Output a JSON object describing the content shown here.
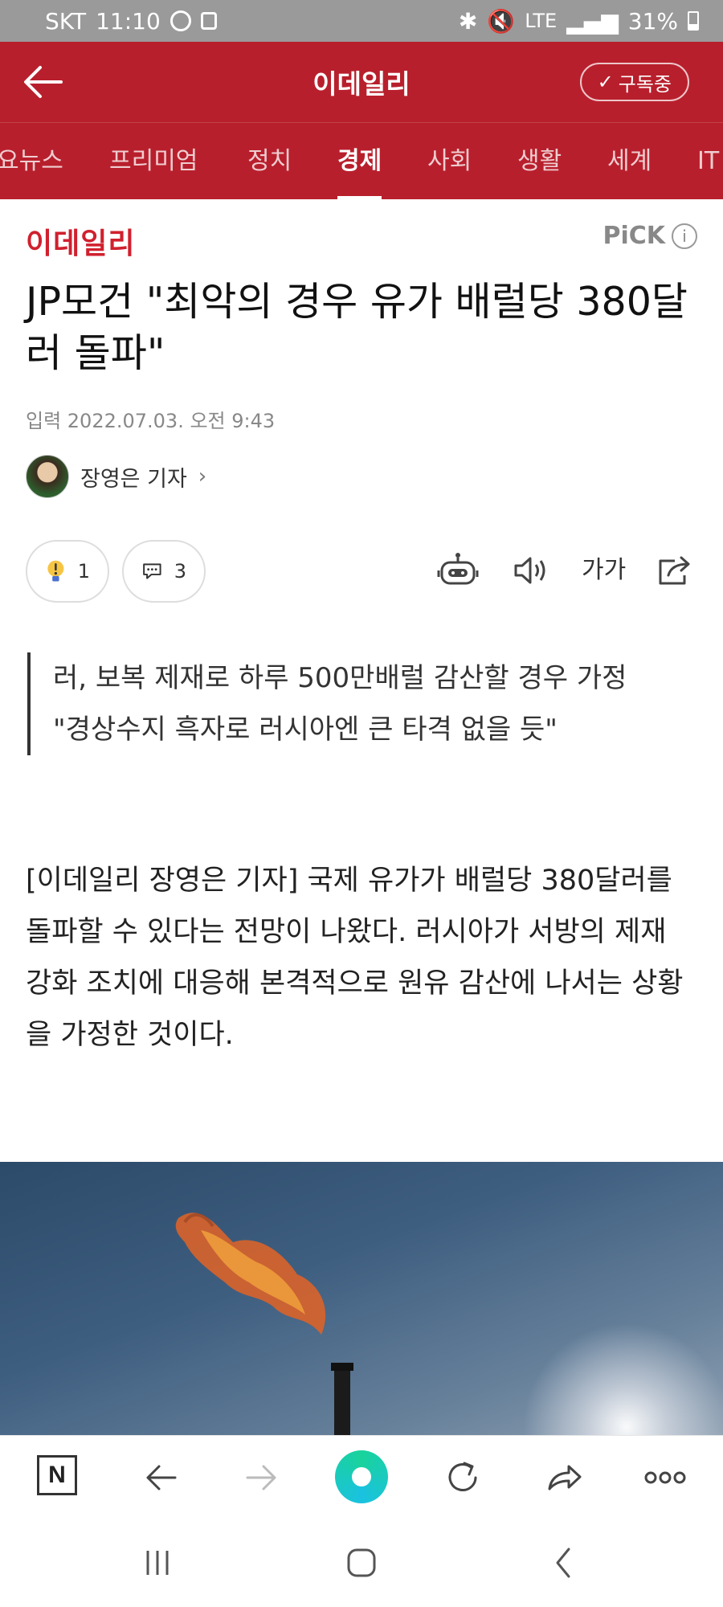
{
  "status_bar": {
    "carrier": "SKT",
    "time": "11:10",
    "network": "LTE",
    "battery": "31%"
  },
  "header": {
    "title": "이데일리",
    "subscribe_label": "구독중"
  },
  "tabs": [
    "요뉴스",
    "프리미엄",
    "정치",
    "경제",
    "사회",
    "생활",
    "세계",
    "IT"
  ],
  "active_tab": "경제",
  "article": {
    "press_logo": "이데일리",
    "pick_label": "PiCK",
    "title": "JP모건 \"최악의 경우 유가 배럴당 380달러 돌파\"",
    "date": "입력 2022.07.03. 오전 9:43",
    "author": "장영은 기자",
    "reaction_count": "1",
    "comment_count": "3",
    "font_size_label": "가가",
    "summary": [
      "러, 보복 제재로 하루 500만배럴 감산할 경우 가정",
      "\"경상수지 흑자로 러시아엔 큰 타격 없을 듯\""
    ],
    "body": "[이데일리 장영은 기자] 국제 유가가 배럴당 380달러를 돌파할 수 있다는 전망이 나왔다. 러시아가 서방의 제재 강화 조치에 대응해 본격적으로 원유 감산에 나서는 상황을 가정한 것이다."
  },
  "browser_toolbar": {
    "home_label": "N"
  },
  "colors": {
    "brand": "#b81f2c",
    "accent_green": "#19d39b"
  }
}
